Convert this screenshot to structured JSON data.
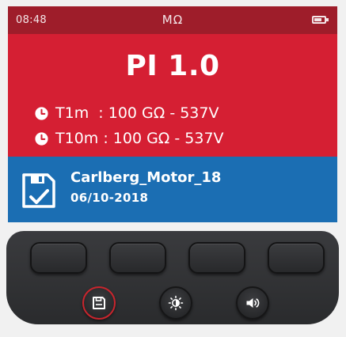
{
  "status_bar": {
    "time": "08:48",
    "unit": "MΩ",
    "battery_icon": "battery-icon",
    "background_color": "#9e1d2a"
  },
  "result": {
    "headline": "PI 1.0",
    "background_color": "#d51f33",
    "measurements": [
      {
        "icon": "clock-icon",
        "label": "T1m",
        "separator": "  : ",
        "value": "100 GΩ - 537V"
      },
      {
        "icon": "clock-icon",
        "label": "T10m",
        "separator": " : ",
        "value": "100 GΩ - 537V"
      }
    ]
  },
  "file": {
    "icon": "save-file-check-icon",
    "name": "Carlberg_Motor_18",
    "date": "06/10-2018",
    "background_color": "#1b6eb3"
  },
  "keypad": {
    "softkeys": [
      "softkey-1",
      "softkey-2",
      "softkey-3",
      "softkey-4"
    ],
    "round_buttons": [
      {
        "icon": "save-icon",
        "highlight_color": "#c9252d"
      },
      {
        "icon": "brightness-icon"
      },
      {
        "icon": "speaker-icon"
      }
    ]
  }
}
